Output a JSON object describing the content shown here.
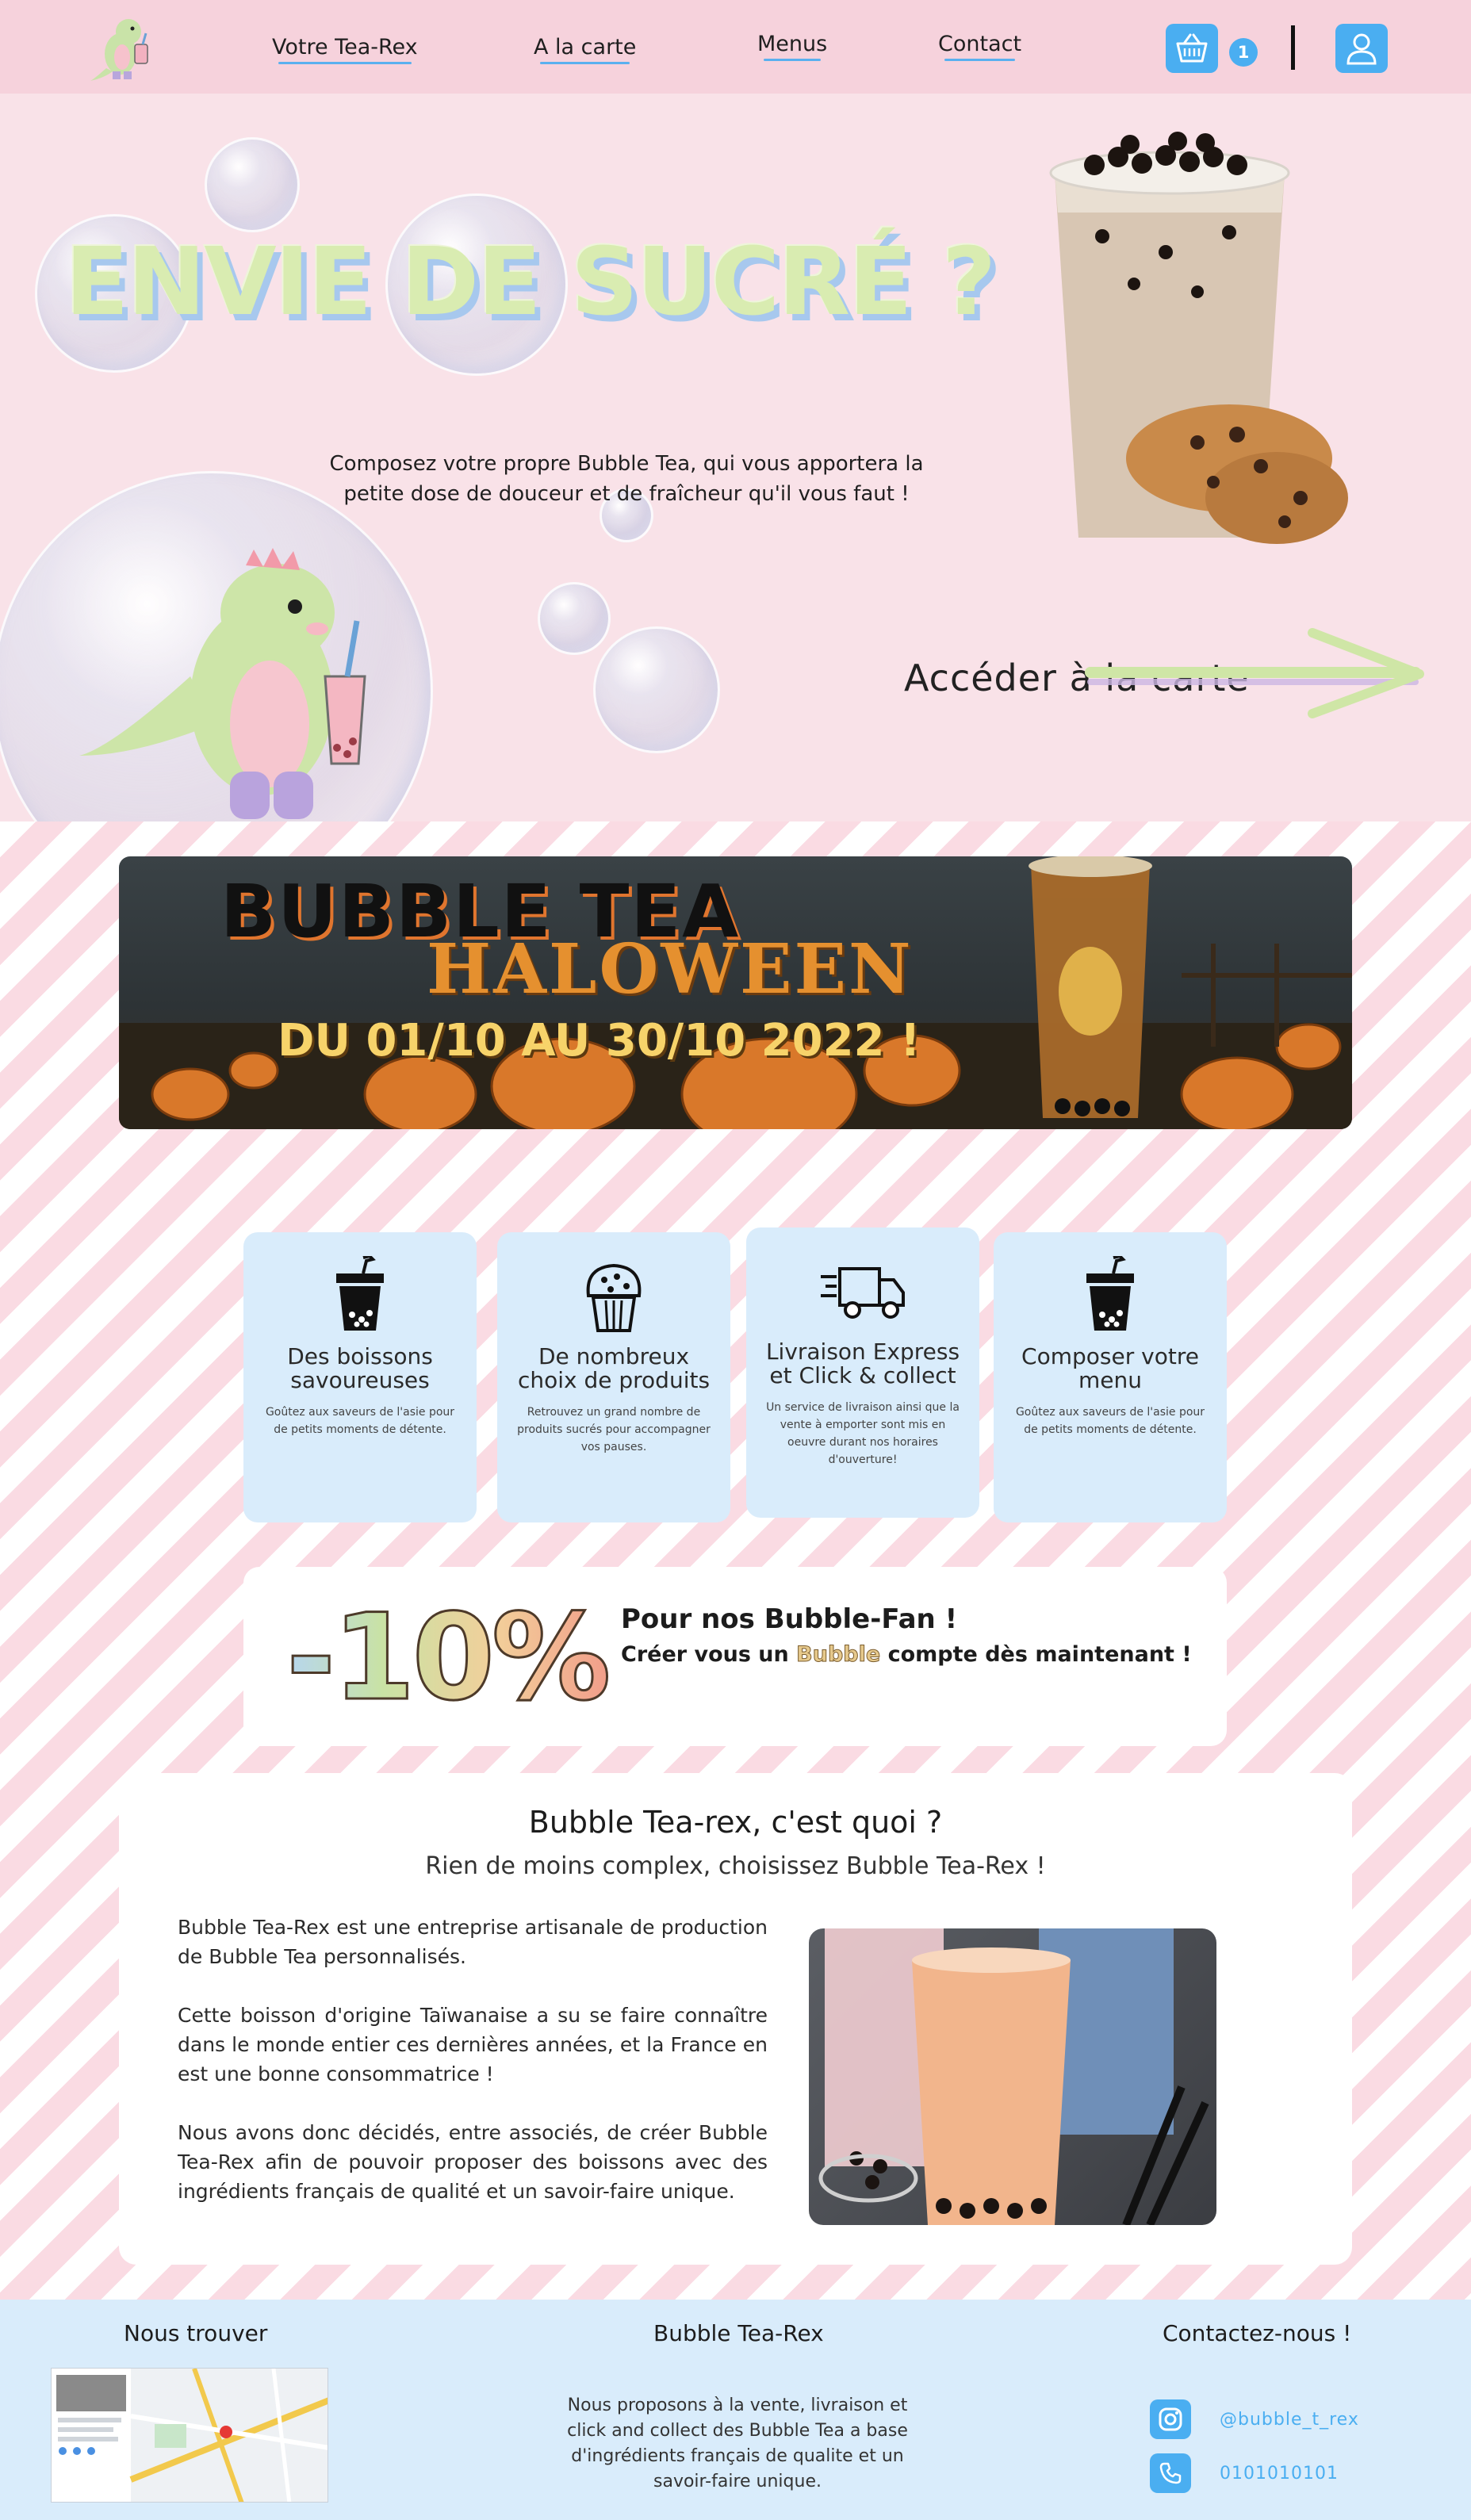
{
  "nav": {
    "links": [
      "Votre Tea-Rex",
      "A la carte",
      "Menus",
      "Contact"
    ],
    "cart_count": "1"
  },
  "hero": {
    "title": "ENVIE DE SUCRÉ ?",
    "subtitle_line1": "Composez votre propre Bubble Tea, qui vous apportera la",
    "subtitle_line2": "petite dose de douceur et de fraîcheur qu'il vous faut !",
    "cta": "Accéder à la carte"
  },
  "banner": {
    "title1": "BUBBLE TEA",
    "title2": "HALOWEEN",
    "dates": "DU 01/10 AU 30/10 2022 !"
  },
  "features": [
    {
      "icon": "bubble-tea-cup-icon",
      "title": "Des boissons savoureuses",
      "desc": "Goûtez aux saveurs de l'asie pour de petits moments de détente."
    },
    {
      "icon": "muffin-icon",
      "title": "De nombreux choix de produits",
      "desc": "Retrouvez un grand nombre de produits sucrés pour accompagner vos pauses."
    },
    {
      "icon": "delivery-truck-icon",
      "title": "Livraison Express et Click & collect",
      "desc": "Un service de livraison ainsi que la vente à emporter sont mis en oeuvre durant nos horaires d'ouverture!"
    },
    {
      "icon": "bubble-tea-cup-icon",
      "title": "Composer votre menu",
      "desc": "Goûtez aux saveurs de l'asie pour de petits moments de détente."
    }
  ],
  "promo": {
    "number": "-10%",
    "title": "Pour nos Bubble-Fan !",
    "sub_before": "Créer vous un ",
    "sub_highlight": "Bubble",
    "sub_after": " compte dès maintenant !"
  },
  "about": {
    "title": "Bubble Tea-rex, c'est quoi ?",
    "subtitle": "Rien de moins complex, choisissez Bubble Tea-Rex !",
    "paragraphs": [
      "Bubble Tea-Rex est une entreprise artisanale de production de Bubble Tea personnalisés.",
      "Cette boisson d'origine Taïwanaise a su se faire connaître dans le monde entier ces dernières années, et la France en est une bonne consommatrice !",
      "Nous avons donc décidés, entre associés, de créer Bubble Tea-Rex afin de pouvoir proposer des boissons avec des ingrédients français de qualité et un savoir-faire unique."
    ]
  },
  "footer": {
    "find_heading": "Nous trouver",
    "brand_heading": "Bubble Tea-Rex",
    "brand_desc": "Nous proposons à la vente, livraison et click and collect des Bubble Tea a base d'ingrédients français de qualite et un savoir-faire unique.",
    "contact_heading": "Contactez-nous !",
    "instagram": "@bubble_t_rex",
    "phone": "0101010101"
  },
  "colors": {
    "accent": "#4aaef1",
    "nav_bg": "#f6d2dc",
    "hero_bg": "#f9e2e8",
    "stripe_pink": "#fadbe3",
    "card_blue": "#d9ecfb",
    "title_green": "#d9ecb1"
  }
}
